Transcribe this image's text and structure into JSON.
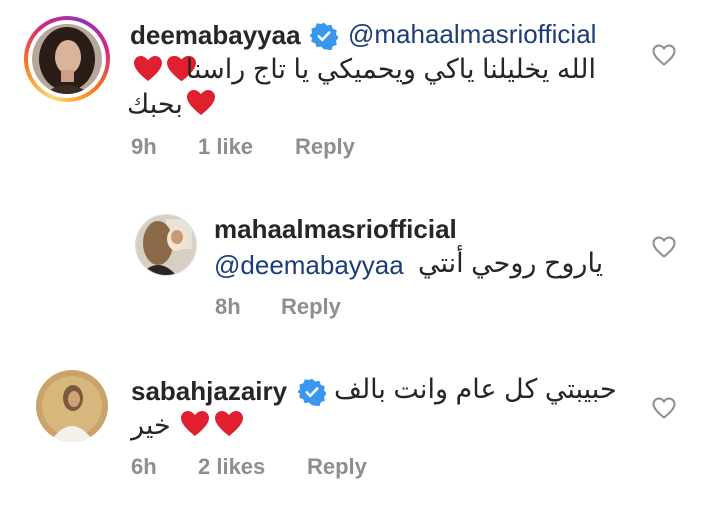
{
  "comments": [
    {
      "username": "deemabayyaa",
      "mention": "@mahaalmasriofficial",
      "text_line1": "الله يخليلنا ياكي ويحميكي يا تاج راسنا",
      "text_line2": "بحبك",
      "time": "9h",
      "likes": "1 like",
      "reply_label": "Reply",
      "verified": true,
      "has_story": true
    },
    {
      "username": "mahaalmasriofficial",
      "text_arabic": "ياروح روحي أنتي",
      "mention": "@deemabayyaa",
      "time": "8h",
      "reply_label": "Reply",
      "verified": false
    },
    {
      "username": "sabahjazairy",
      "text_line1": "حبيبتي كل عام وانت بالف",
      "text_line2": "خير",
      "time": "6h",
      "likes": "2 likes",
      "reply_label": "Reply",
      "verified": true
    }
  ],
  "icons": {
    "verified": "verified-badge-icon",
    "like": "heart-outline-icon",
    "emoji": "red-heart-emoji"
  },
  "colors": {
    "verified_blue": "#3897f0",
    "mention_blue": "#1d3c7a",
    "meta_gray": "#8e8e8e",
    "heart_red": "#e0202e"
  }
}
